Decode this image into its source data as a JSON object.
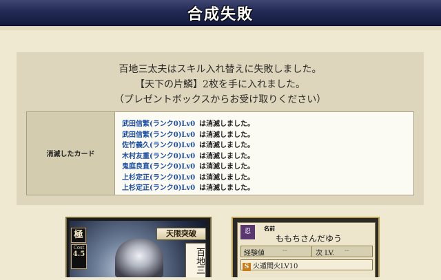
{
  "header": {
    "title": "合成失敗"
  },
  "message": {
    "line1": "百地三太夫はスキル入れ替えに失敗しました。",
    "line2": "【天下の片鱗】2枚を手に入れました。",
    "line3": "（プレゼントボックスからお受け取りください）"
  },
  "consumed": {
    "heading": "消滅したカード",
    "status": "は消滅しました。",
    "cards": [
      "武田信繁(ランク0)Lv0",
      "武田信繁(ランク0)Lv0",
      "佐竹義久(ランク0)Lv0",
      "木村友重(ランク0)Lv0",
      "鬼庭良直(ランク0)Lv0",
      "上杉定正(ランク0)Lv0",
      "上杉定正(ランク0)Lv0"
    ]
  },
  "card1": {
    "rarity": "極",
    "cost_label": "Cost",
    "cost_value": "4.5",
    "skill": "天限突破",
    "name": "百地三"
  },
  "card2": {
    "clan_icon": "忍",
    "name_label": "名前",
    "name": "ももちさんだゆう",
    "exp_label": "経験値",
    "exp_value": "--",
    "next_label": "次 LV.",
    "next_value": "--",
    "skill_badge": "S",
    "skill": "火遁閻火LV10"
  }
}
